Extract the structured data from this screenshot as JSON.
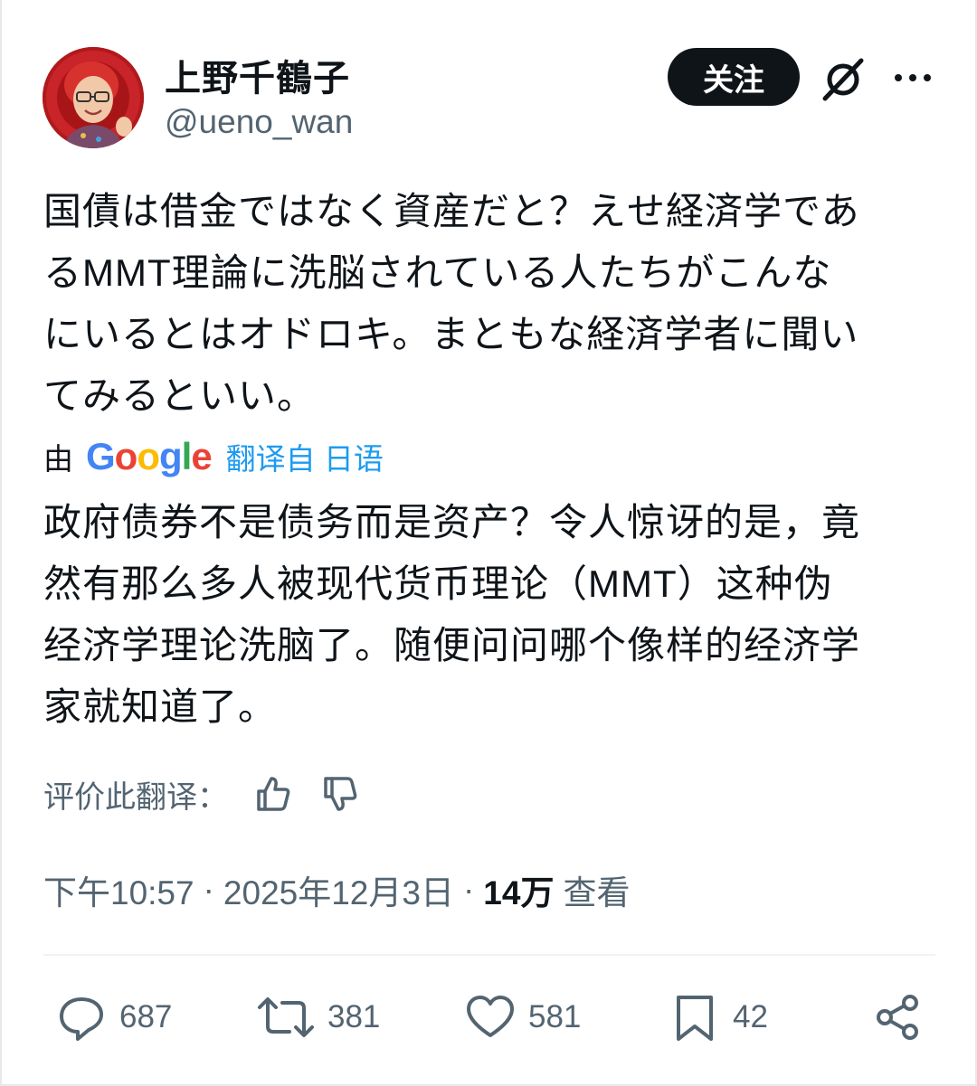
{
  "author": {
    "display_name": "上野千鶴子",
    "handle": "@ueno_wan",
    "follow_label": "关注"
  },
  "tweet": {
    "text": "国債は借金ではなく資産だと？えせ経済学であ\nるMMT理論に洗脳されている人たちがこんな\nにいるとはオドロキ。まともな経済学者に聞い\nてみるといい。"
  },
  "translation": {
    "prefix": "由",
    "provider": "Google",
    "link_label": "翻译自 日语",
    "text": "政府债券不是债务而是资产？令人惊讶的是，竟\n然有那么多人被现代货币理论（MMT）这种伪\n经济学理论洗脑了。随便问问哪个像样的经济学\n家就知道了。",
    "rate_label": "评价此翻译："
  },
  "meta": {
    "time": "下午10:57",
    "separator": "·",
    "date": "2025年12月3日",
    "views_count": "14万",
    "views_label": "查看"
  },
  "actions": {
    "replies": "687",
    "reposts": "381",
    "likes": "581",
    "bookmarks": "42"
  },
  "icons": {
    "grok": "grok-icon",
    "more": "more-icon",
    "thumbs_up": "thumbs-up-icon",
    "thumbs_down": "thumbs-down-icon",
    "reply": "reply-icon",
    "repost": "repost-icon",
    "like": "like-icon",
    "bookmark": "bookmark-icon",
    "share": "share-icon"
  },
  "colors": {
    "text": "#0f1419",
    "secondary": "#536471",
    "link": "#1d9bf0",
    "follow_bg": "#0f1419"
  }
}
